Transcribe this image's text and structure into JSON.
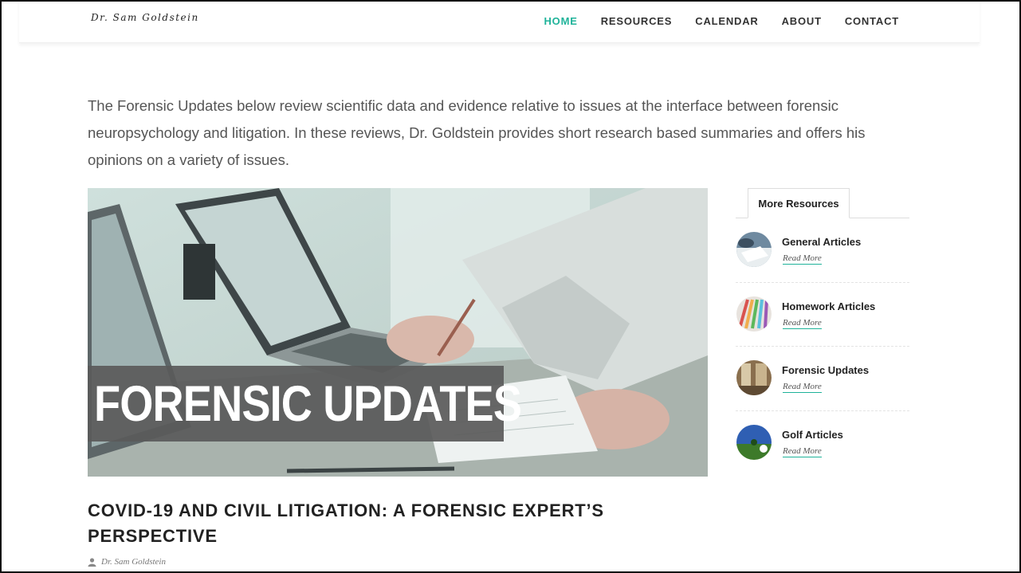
{
  "header": {
    "logo_text": "Dr. Sam Goldstein",
    "nav": [
      {
        "label": "HOME",
        "active": true
      },
      {
        "label": "RESOURCES",
        "active": false
      },
      {
        "label": "CALENDAR",
        "active": false
      },
      {
        "label": "ABOUT",
        "active": false
      },
      {
        "label": "CONTACT",
        "active": false
      }
    ],
    "accent_color": "#1fb39a"
  },
  "intro": {
    "text": "The Forensic Updates below review scientific data and evidence relative to issues at the interface between forensic neuropsychology and litigation. In these reviews, Dr. Goldstein provides short research based summaries and offers his opinions on a variety of issues."
  },
  "hero": {
    "banner_text": "FORENSIC UPDATES"
  },
  "post": {
    "title": "COVID-19 AND CIVIL LITIGATION: A FORENSIC EXPERT’S PERSPECTIVE",
    "author": "Dr. Sam Goldstein",
    "author_icon": "user-icon"
  },
  "sidebar": {
    "tab_label": "More Resources",
    "items": [
      {
        "title": "General Articles",
        "link": "Read More",
        "thumb": "general-articles-thumb"
      },
      {
        "title": "Homework Articles",
        "link": "Read More",
        "thumb": "homework-articles-thumb"
      },
      {
        "title": "Forensic Updates",
        "link": "Read More",
        "thumb": "forensic-updates-thumb"
      },
      {
        "title": "Golf Articles",
        "link": "Read More",
        "thumb": "golf-articles-thumb"
      }
    ]
  }
}
